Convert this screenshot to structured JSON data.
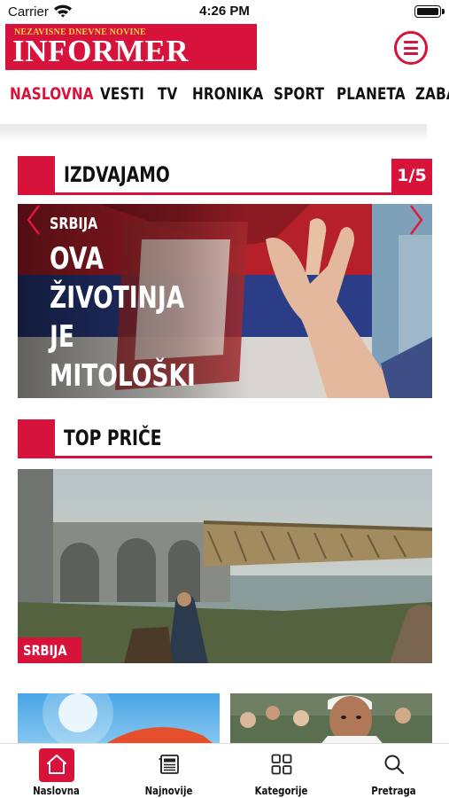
{
  "status_bar": {
    "carrier": "Carrier",
    "time": "4:26 PM"
  },
  "header": {
    "logo_subtitle": "NEZAVISNE DNEVNE NOVINE",
    "logo_title": "INFORMER"
  },
  "nav": {
    "items": [
      "NASLOVNA",
      "VESTI",
      "TV",
      "HRONIKA",
      "SPORT",
      "PLANETA",
      "ZABA"
    ],
    "active": "NASLOVNA"
  },
  "featured": {
    "title": "IZDVAJAMO",
    "pager": "1/5",
    "slide": {
      "category": "SRBIJA",
      "title": "OVA ŽIVOTINJA JE MITOLOŠKI PREDSTAVNI..."
    }
  },
  "top_stories": {
    "title": "TOP PRIČE",
    "story": {
      "category": "SRBIJA"
    }
  },
  "tabbar": {
    "items": [
      {
        "label": "Naslovna",
        "icon": "home-icon",
        "active": true
      },
      {
        "label": "Najnovije",
        "icon": "newspaper-icon",
        "active": false
      },
      {
        "label": "Kategorije",
        "icon": "grid-icon",
        "active": false
      },
      {
        "label": "Pretraga",
        "icon": "search-icon",
        "active": false
      }
    ]
  },
  "colors": {
    "brand": "#d7133c",
    "logo_subtitle": "#f6d34a",
    "text": "#111111"
  }
}
